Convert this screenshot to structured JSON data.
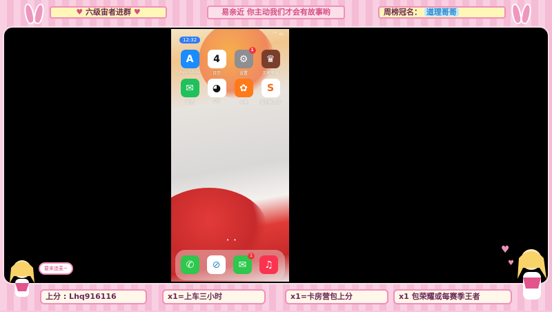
{
  "top": {
    "left_banner": "六级宙者进群",
    "center_banner": "易亲近 你主动我们才会有故事哟",
    "right_banner_label": "周榜冠名：",
    "right_banner_name": "道理哥哥"
  },
  "phone": {
    "status_time": "12:32",
    "status_icons": "⌔ ▭",
    "apps": [
      {
        "label": "App Store",
        "icon": "appstore-icon",
        "color": "#1a8cff",
        "glyph": "A"
      },
      {
        "label": "日历",
        "icon": "calendar-icon",
        "color": "#ffffff",
        "glyph": "4",
        "sub": "周三"
      },
      {
        "label": "设置",
        "icon": "settings-icon",
        "color": "#8e8e93",
        "glyph": "⚙",
        "badge": "1"
      },
      {
        "label": "王者荣耀",
        "icon": "game-icon",
        "color": "#7a3f2c",
        "glyph": "♛"
      },
      {
        "label": "微信",
        "icon": "wechat-icon",
        "color": "#20c05c",
        "glyph": "✉"
      },
      {
        "label": "QQ",
        "icon": "qq-icon",
        "color": "#ffffff",
        "glyph": "◕"
      },
      {
        "label": "斗鱼",
        "icon": "douyu-icon",
        "color": "#ff7a1a",
        "glyph": "✿"
      },
      {
        "label": "搜狗输入法",
        "icon": "sogou-icon",
        "color": "#ffffff",
        "glyph": "S"
      }
    ],
    "dock": [
      {
        "icon": "phone-icon",
        "color": "#2dc84d",
        "glyph": "✆"
      },
      {
        "icon": "safari-icon",
        "color": "#ffffff",
        "glyph": "⊘"
      },
      {
        "icon": "messages-icon",
        "color": "#2dc84d",
        "glyph": "✉",
        "badge": "1"
      },
      {
        "icon": "music-icon",
        "color": "#fa3350",
        "glyph": "♫"
      }
    ],
    "page_dots": "• •"
  },
  "bottom": {
    "pill1": "上分 : Lhq916116",
    "pill2": "x1=上车三小时",
    "pill3": "x1=卡房营包上分",
    "pill4": "x1 包荣耀或每赛季王者"
  },
  "speech": "要来连麦~"
}
